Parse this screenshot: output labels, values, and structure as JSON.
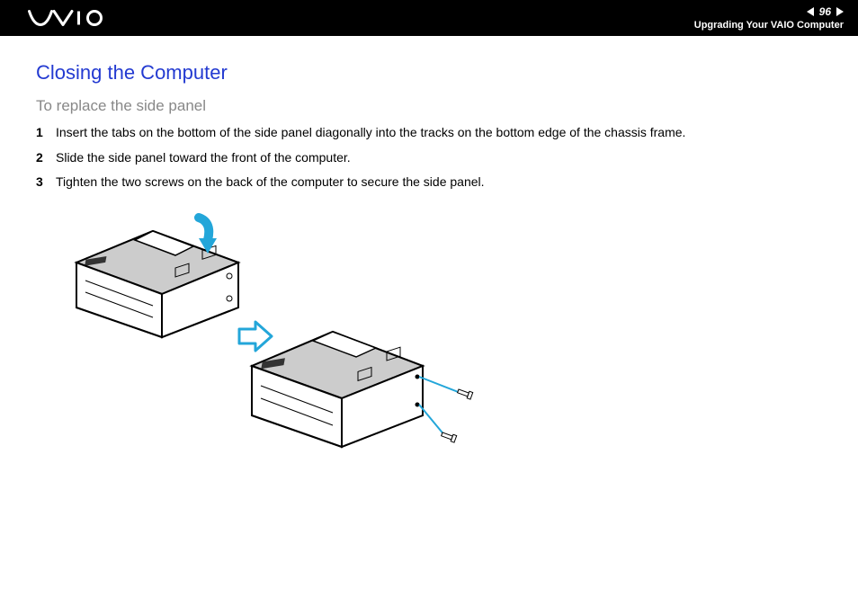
{
  "header": {
    "page_number": "96",
    "section": "Upgrading Your VAIO Computer"
  },
  "content": {
    "title": "Closing the Computer",
    "subtitle": "To replace the side panel",
    "steps": [
      {
        "n": "1",
        "text": "Insert the tabs on the bottom of the side panel diagonally into the tracks on the bottom edge of the chassis frame."
      },
      {
        "n": "2",
        "text": "Slide the side panel toward the front of the computer."
      },
      {
        "n": "3",
        "text": "Tighten the two screws on the back of the computer to secure the side panel."
      }
    ]
  }
}
